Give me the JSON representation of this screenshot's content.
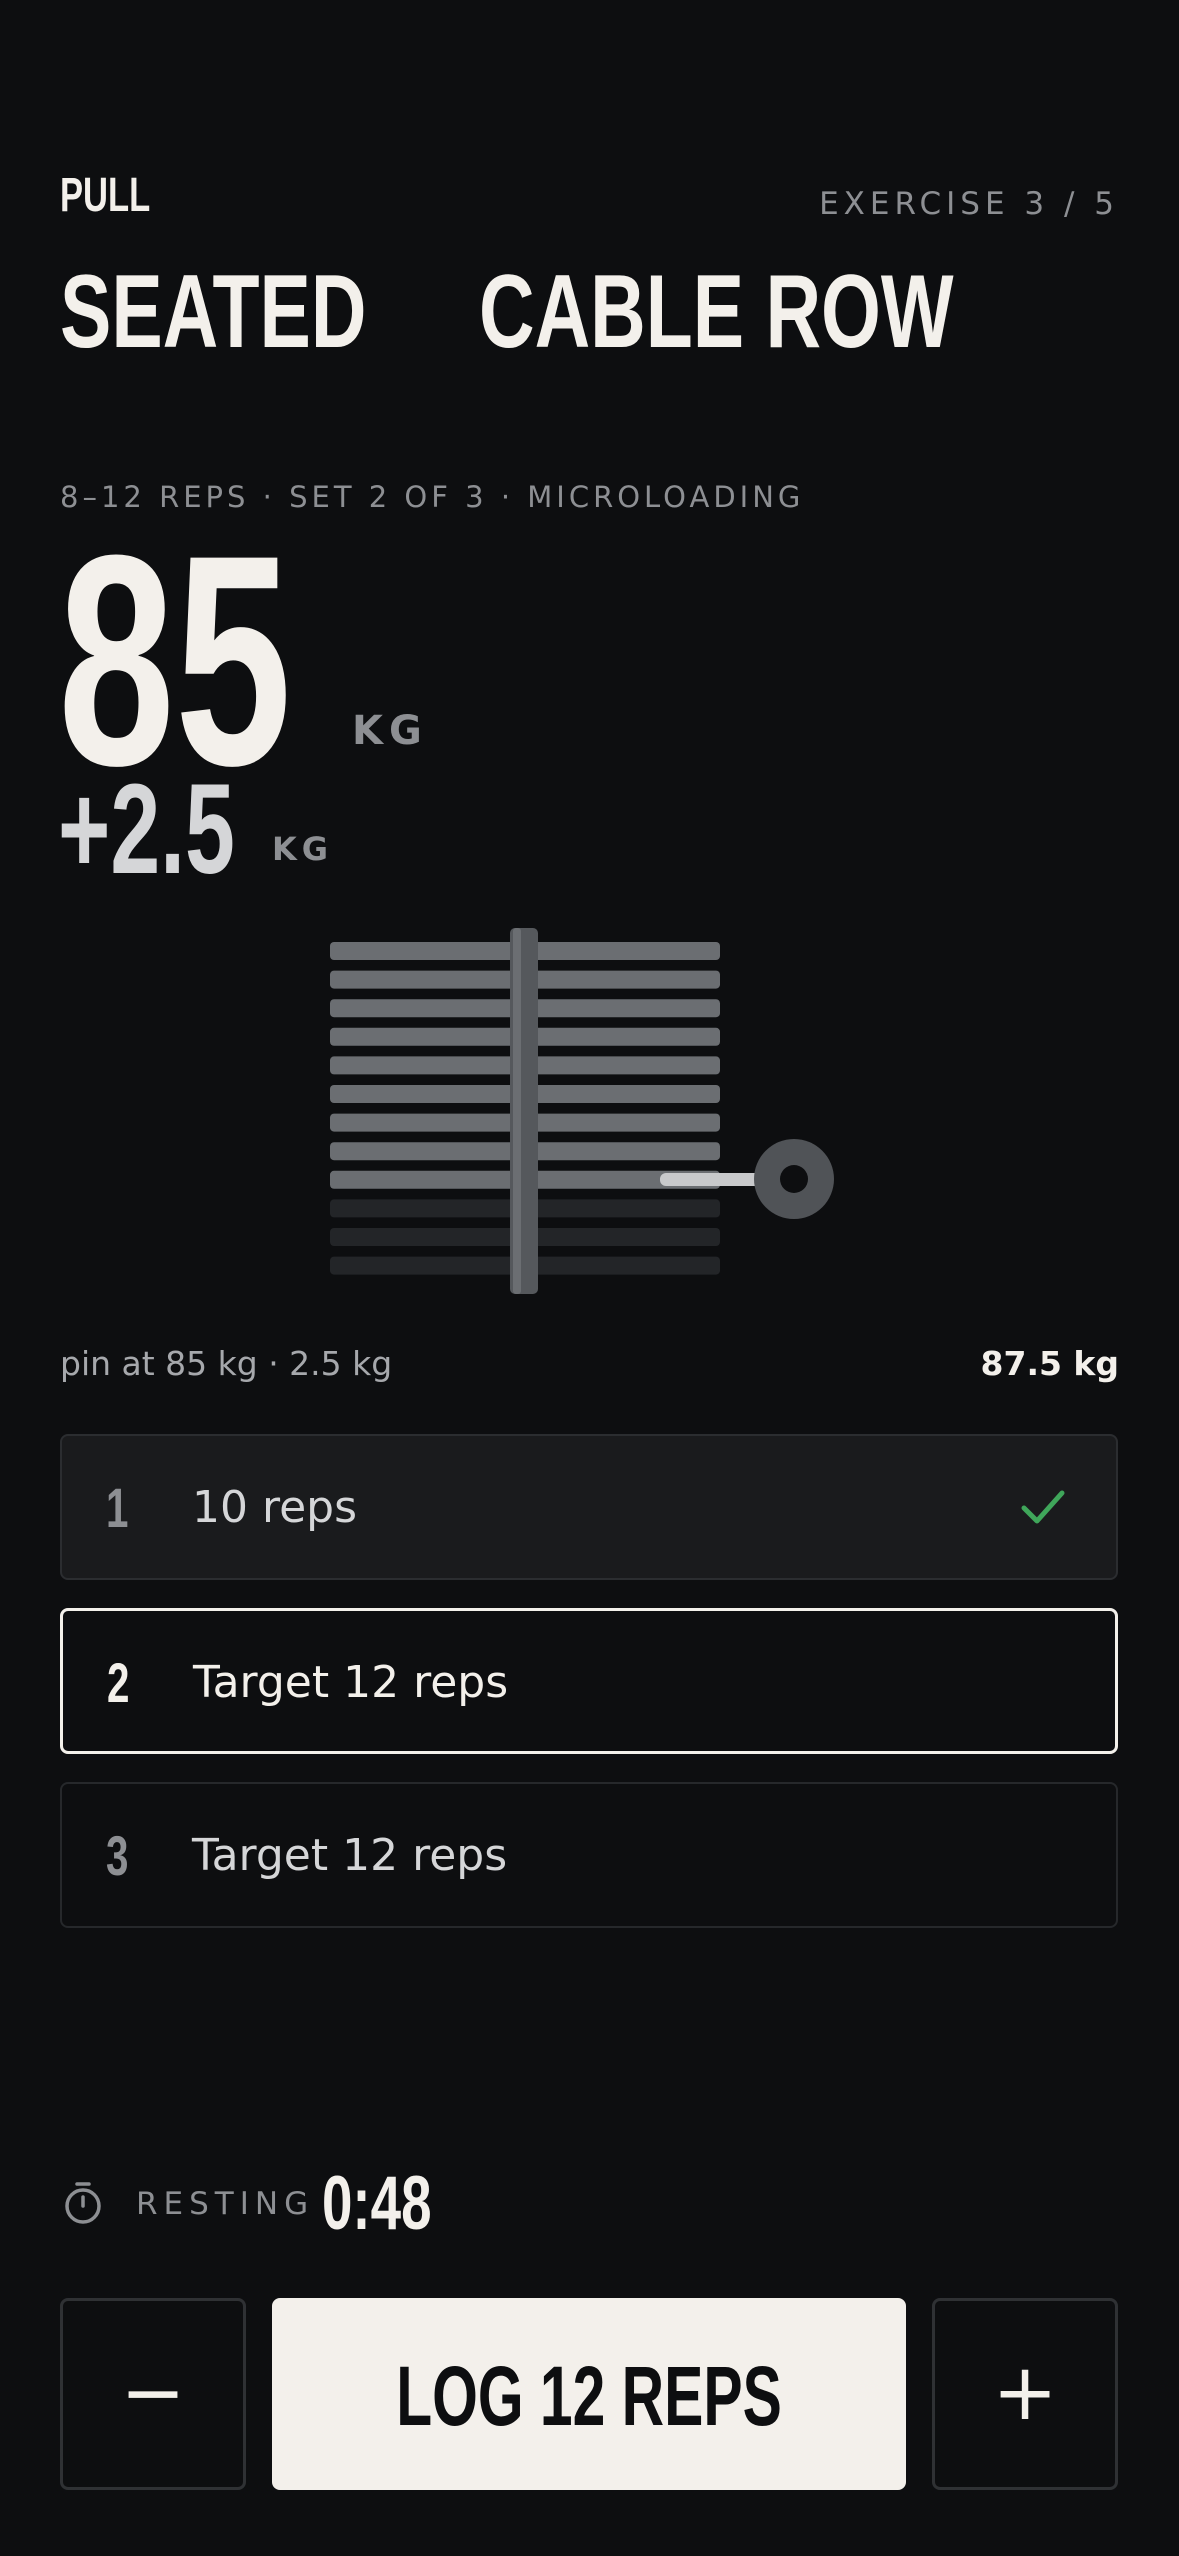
{
  "header": {
    "category": "PULL",
    "progress": "EXERCISE 3 / 5"
  },
  "exercise": {
    "title_line1": "SEATED",
    "title_line2": "CABLE ROW",
    "subtitle": "8–12 REPS · SET 2 OF 3 · MICROLOADING"
  },
  "weight": {
    "value": "85",
    "unit": "KG",
    "increment": "+2.5",
    "increment_unit": "KG"
  },
  "stack": {
    "plate_count": 12,
    "selected_plates": 9,
    "pin_note": "pin at 85 kg · 2.5 kg",
    "total": "87.5 kg"
  },
  "sets": [
    {
      "number": "1",
      "label": "10 reps",
      "state": "done"
    },
    {
      "number": "2",
      "label": "Target 12 reps",
      "state": "active"
    },
    {
      "number": "3",
      "label": "Target 12 reps",
      "state": "upcoming"
    }
  ],
  "rest": {
    "icon": "stopwatch-icon",
    "label": "RESTING",
    "time": "0:48"
  },
  "actions": {
    "decrement": "−",
    "log": "LOG 12 REPS",
    "increment": "+"
  },
  "colors": {
    "background": "#0d0e10",
    "text": "#f3f0eb",
    "muted": "#8d8f93",
    "done_check": "#3fa65a"
  }
}
